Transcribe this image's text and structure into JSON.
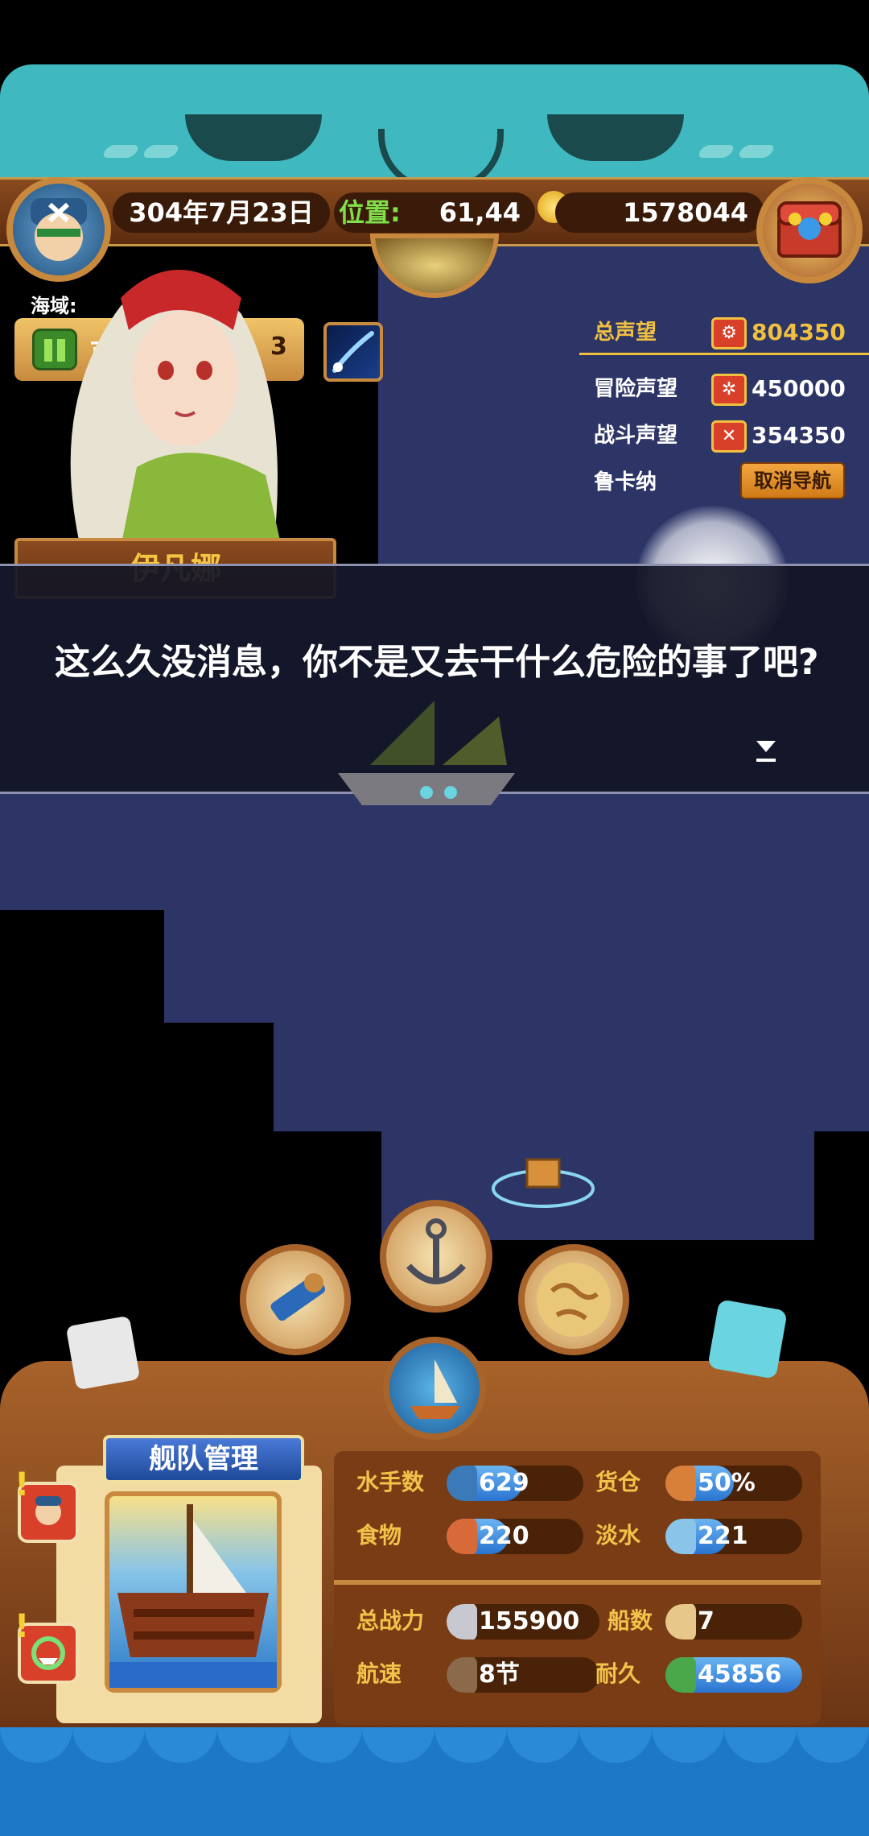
{
  "top_bar": {
    "date": "304年7月23日",
    "position_label": "位置:",
    "position_value": "61,44",
    "gold": "1578044"
  },
  "region": {
    "label": "海域:",
    "partial_text": "可",
    "partial_num": "3"
  },
  "reputation": {
    "total_label": "总声望",
    "total_value": "804350",
    "adventure_label": "冒险声望",
    "adventure_value": "450000",
    "battle_label": "战斗声望",
    "battle_value": "354350",
    "destination": "鲁卡纳",
    "cancel_nav_label": "取消导航"
  },
  "dialog": {
    "speaker": "伊凡娜",
    "text": "这么久没消息，你不是又去干什么危险的事了吧?"
  },
  "fleet": {
    "title": "舰队管理",
    "sailors_label": "水手数",
    "sailors_value": "629",
    "sailors_fill": 0.55,
    "cargo_label": "货仓",
    "cargo_value": "50%",
    "cargo_fill": 0.5,
    "food_label": "食物",
    "food_value": "220",
    "food_fill": 0.45,
    "water_label": "淡水",
    "water_value": "221",
    "water_fill": 0.45,
    "power_label": "总战力",
    "power_value": "155900",
    "ships_label": "船数",
    "ships_value": "7",
    "speed_label": "航速",
    "speed_value": "8节",
    "durability_label": "耐久",
    "durability_value": "45856",
    "durability_fill": 1.0
  },
  "colors": {
    "accent_gold": "#f0c040",
    "bar_blue": "#2a74d0",
    "panel_brown": "#7a3c14"
  }
}
